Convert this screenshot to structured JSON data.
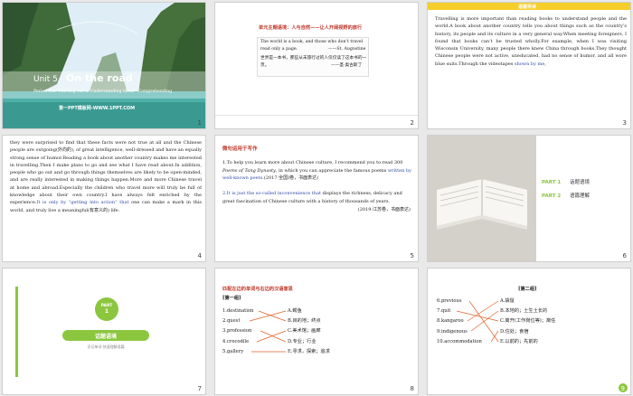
{
  "slides": {
    "s1": {
      "unit": "Unit 5",
      "title": "On the road",
      "subtitle": "Period One   Starting out & Understanding ideas—Comprehending",
      "watermark": "第一PPT模板网-WWW.1PPT.COM",
      "num": "1"
    },
    "s2": {
      "header": "单元主题语境：人与自然——让人开阔视野的旅行",
      "quote_en": "The world is a book, and those who don’t travel read only a page.",
      "quote_author": "——St. Augustine",
      "quote_cn": "世界是一本书，那些从未旅行过的人仅仅读了这本书的一页。",
      "quote_cn_author": "——圣·奥古斯丁",
      "num": "2"
    },
    "s3": {
      "header": "语篇导读",
      "text": "Travelling is more important than reading books to understand people and the world.A book about another country tells you about things such as the country’s history, its people and its culture in a very general way.When meeting foreigners, I found that books can’t be trusted wholly.For example, when I was visiting Wisconsin University, many people there knew China through books.They thought Chinese people were not active, uneducated, had no sense of humor, and all wore blue suits.Through the videotapes",
      "text_blue": "shown by me",
      "text_end": ",",
      "num": "3"
    },
    "s4": {
      "text": "they were surprised to find that these facts were not true at all and the Chinese people are outgoing(外向的), of great intelligence, well-dressed and have an equally strong sense of humor.Reading a book about another country makes me interested in travelling.Then I make plans to go and see what I have read about.In addition, people who go out and go through things themselves are likely to be open-minded, and are really interested in making things happen.More and more Chinese travel at home and abroad.Especially the children who travel more will truly be full of knowledge about their own country.I have always felt enriched by the experience.",
      "text_blue": "It is only by “getting into action” that",
      "text_end": " one can make a mark in this world, and truly live a meaningful(有意义的) life.",
      "num": "4"
    },
    "s5": {
      "header": "微句运用于写作",
      "item1_a": "1.To help you learn more about Chinese culture, I recommend you to read 300 ",
      "item1_italic": "Poems of Tang Dynasty",
      "item1_b": ", in which you can appreciate the famous poems ",
      "item1_blue": "written by well-known poets",
      "item1_c": ".(2017·全国Ⅰ卷，书面表达)",
      "item2_blue": "2.It is just the so-called inconvenience that",
      "item2_b": " displays the richness, delicacy and great fascination of Chinese culture with a history of thousands of years.",
      "item2_src": "(2019·江苏卷，书面表达)",
      "num": "5"
    },
    "s6": {
      "parts": [
        {
          "label": "PART 1",
          "title": "话题语境"
        },
        {
          "label": "PART 2",
          "title": "语篇理解"
        }
      ],
      "num": "6"
    },
    "s7": {
      "badge": "PART",
      "badge_num": "1",
      "title": "话题语境",
      "sub": "识记单词  快速理解语篇",
      "num": "7"
    },
    "s8": {
      "header": "匹配左边的单词与右边的汉语意思",
      "group": "[第一组]",
      "left": [
        "1.destination",
        "2.quest",
        "3.profession",
        "4.crocodile",
        "5.gallery"
      ],
      "right": [
        "A.鳄鱼",
        "B.目的地；终点",
        "C.美术馆；画廊",
        "D.专业；行业",
        "E.寻求，探索；追求"
      ],
      "num": "8"
    },
    "s9": {
      "group": "[第二组]",
      "left": [
        "6.previous",
        "7.quit",
        "8.kangaroo",
        "9.indigenous",
        "10.accommodation"
      ],
      "right": [
        "A.袋鼠",
        "B.本地的；土生土长的",
        "C.离开(工作岗位等)；离任",
        "D.住处；食宿",
        "E.以前的；先前的"
      ],
      "num": "9"
    }
  },
  "colors": {
    "accent_green": "#8cc63f",
    "match_line": "#e0632a",
    "header_red": "#c0392b",
    "link_blue": "#2e4aa8",
    "yellow_bar": "#f5ce2a"
  }
}
